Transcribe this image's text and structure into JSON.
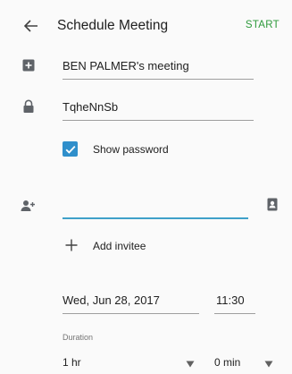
{
  "toolbar": {
    "title": "Schedule Meeting",
    "start_label": "START"
  },
  "meeting": {
    "topic_value": "BEN PALMER's meeting",
    "password_value": "TqheNnSb",
    "show_password_label": "Show password",
    "show_password_checked": true
  },
  "invitees": {
    "input_value": "",
    "add_label": "Add invitee"
  },
  "schedule": {
    "date_value": "Wed, Jun 28, 2017",
    "time_value": "11:30",
    "duration_label": "Duration",
    "duration_hours": "1 hr",
    "duration_minutes": "0 min"
  },
  "colors": {
    "accent": "#2e9a3c",
    "checkbox": "#2f8fcb",
    "active_underline": "#3fa0c9"
  }
}
